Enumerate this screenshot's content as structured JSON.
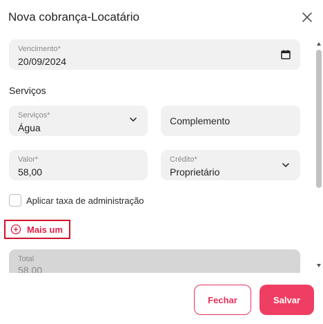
{
  "dialog": {
    "title": "Nova cobrança-Locatário",
    "close_icon": "close-icon"
  },
  "due_date": {
    "label": "Vencimento*",
    "value": "20/09/2024",
    "icon": "calendar-icon"
  },
  "services_section": {
    "heading": "Serviços"
  },
  "service_select": {
    "label": "Serviços*",
    "value": "Água",
    "icon": "chevron-down-icon"
  },
  "complement": {
    "placeholder": "Complemento"
  },
  "amount": {
    "label": "Valor*",
    "value": "58,00"
  },
  "credit_select": {
    "label": "Crédito*",
    "value": "Proprietário",
    "icon": "chevron-down-icon"
  },
  "admin_fee": {
    "label": "Aplicar taxa de administração",
    "checked": false
  },
  "add_more": {
    "label": "Mais um",
    "icon": "plus-circle-icon",
    "highlight_color": "#d0112b"
  },
  "total": {
    "label": "Total",
    "value": "58,00"
  },
  "footer": {
    "close_label": "Fechar",
    "save_label": "Salvar"
  },
  "colors": {
    "accent": "#ef3e63",
    "field_bg": "#f1f1f1",
    "disabled_bg": "#d6d6d6"
  }
}
